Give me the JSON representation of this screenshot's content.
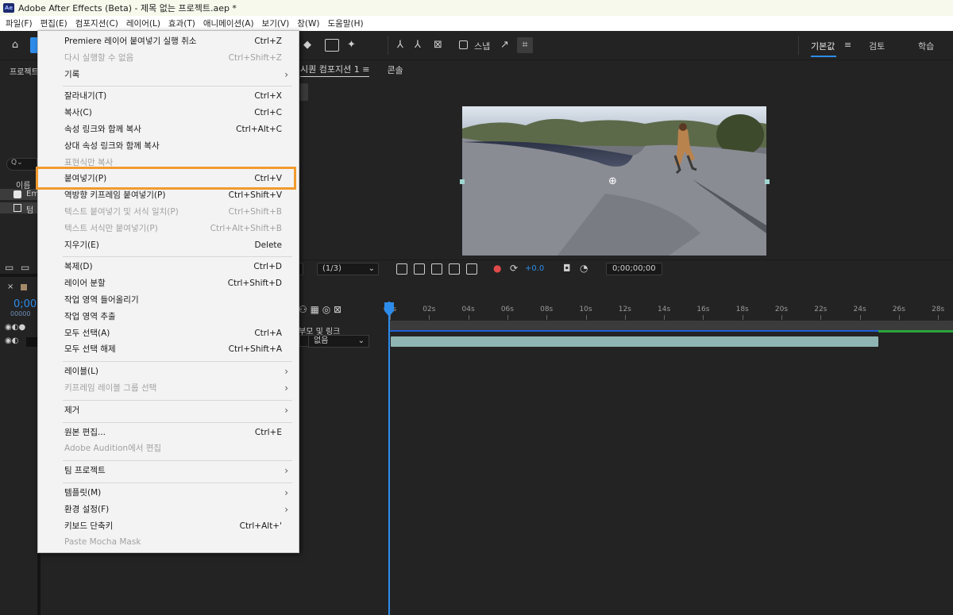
{
  "window": {
    "title": "Adobe After Effects (Beta) - 제목 없는 프로젝트.aep *",
    "app_badge": "Ae"
  },
  "menubar": [
    "파일(F)",
    "편집(E)",
    "컴포지션(C)",
    "레이어(L)",
    "효과(T)",
    "애니메이션(A)",
    "보기(V)",
    "창(W)",
    "도움말(H)"
  ],
  "toolbar": {
    "snap_label": "스냅",
    "workspaces": [
      "기본값",
      "검토",
      "학습"
    ],
    "active_workspace": "기본값",
    "menu_glyph": "≡"
  },
  "left_panel": {
    "tab_label": "프로젝트",
    "column_label": "이름",
    "search_glyph": "Q⌄",
    "item_1": "Em",
    "item_2": "텀"
  },
  "viewer": {
    "tabs": [
      "시퀀 컴포지션 1",
      "콘솔"
    ],
    "tab_menu_glyph": "≡",
    "resolution": "(1/3)",
    "exposure": "+0.0",
    "timecode": "0;00;00;00"
  },
  "timeline": {
    "comp_time": "0;00;",
    "comp_sub": "00000",
    "parent_header": "부모 및 링크",
    "parent_value": "없음",
    "ruler_ticks": [
      "00s",
      "02s",
      "04s",
      "06s",
      "08s",
      "10s",
      "12s",
      "14s",
      "16s",
      "18s",
      "20s",
      "22s",
      "24s",
      "26s",
      "28s"
    ]
  },
  "edit_menu": [
    {
      "label": "Premiere 레이어 붙여넣기 실행 취소",
      "shortcut": "Ctrl+Z",
      "disabled": false
    },
    {
      "label": "다시 실행할 수 없음",
      "shortcut": "Ctrl+Shift+Z",
      "disabled": true
    },
    {
      "label": "기록",
      "shortcut": "",
      "disabled": false,
      "submenu": true
    },
    {
      "separator": true
    },
    {
      "label": "잘라내기(T)",
      "shortcut": "Ctrl+X",
      "disabled": false
    },
    {
      "label": "복사(C)",
      "shortcut": "Ctrl+C",
      "disabled": false
    },
    {
      "label": "속성 링크와 함께 복사",
      "shortcut": "Ctrl+Alt+C",
      "disabled": false
    },
    {
      "label": "상대 속성 링크와 함께 복사",
      "shortcut": "",
      "disabled": false
    },
    {
      "label": "표현식만 복사",
      "shortcut": "",
      "disabled": true
    },
    {
      "label": "붙여넣기(P)",
      "shortcut": "Ctrl+V",
      "disabled": false
    },
    {
      "label": "역방향 키프레임 붙여넣기(P)",
      "shortcut": "Ctrl+Shift+V",
      "disabled": false
    },
    {
      "label": "텍스트 붙여넣기 및 서식 일치(P)",
      "shortcut": "Ctrl+Shift+B",
      "disabled": true
    },
    {
      "label": "텍스트 서식만 붙여넣기(P)",
      "shortcut": "Ctrl+Alt+Shift+B",
      "disabled": true
    },
    {
      "label": "지우기(E)",
      "shortcut": "Delete",
      "disabled": false
    },
    {
      "separator": true
    },
    {
      "label": "복제(D)",
      "shortcut": "Ctrl+D",
      "disabled": false
    },
    {
      "label": "레이어 분할",
      "shortcut": "Ctrl+Shift+D",
      "disabled": false
    },
    {
      "label": "작업 영역 들어올리기",
      "shortcut": "",
      "disabled": false
    },
    {
      "label": "작업 영역 추출",
      "shortcut": "",
      "disabled": false
    },
    {
      "label": "모두 선택(A)",
      "shortcut": "Ctrl+A",
      "disabled": false
    },
    {
      "label": "모두 선택 해제",
      "shortcut": "Ctrl+Shift+A",
      "disabled": false
    },
    {
      "separator": true
    },
    {
      "label": "레이블(L)",
      "shortcut": "",
      "disabled": false,
      "submenu": true
    },
    {
      "label": "키프레임 레이블 그룹 선택",
      "shortcut": "",
      "disabled": true,
      "submenu": true
    },
    {
      "separator": true
    },
    {
      "label": "제거",
      "shortcut": "",
      "disabled": false,
      "submenu": true
    },
    {
      "separator": true
    },
    {
      "label": "원본 편집...",
      "shortcut": "Ctrl+E",
      "disabled": false
    },
    {
      "label": "Adobe Audition에서 편집",
      "shortcut": "",
      "disabled": true
    },
    {
      "separator": true
    },
    {
      "label": "팀 프로젝트",
      "shortcut": "",
      "disabled": false,
      "submenu": true
    },
    {
      "separator": true
    },
    {
      "label": "템플릿(M)",
      "shortcut": "",
      "disabled": false,
      "submenu": true
    },
    {
      "label": "환경 설정(F)",
      "shortcut": "",
      "disabled": false,
      "submenu": true
    },
    {
      "label": "키보드 단축키",
      "shortcut": "Ctrl+Alt+'",
      "disabled": false
    },
    {
      "label": "Paste Mocha Mask",
      "shortcut": "",
      "disabled": true
    }
  ],
  "highlighted_item": "붙여넣기(P)",
  "colors": {
    "accent": "#2d8ceb",
    "highlight_box": "#f29a2e",
    "clip": "#8eb5b4",
    "menu_bg": "#f3f3f3"
  }
}
